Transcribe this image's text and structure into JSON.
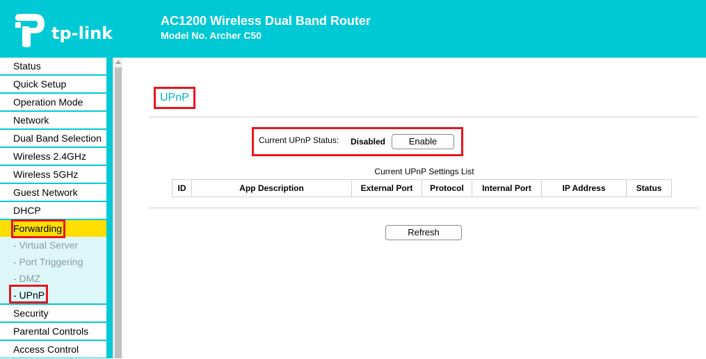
{
  "header": {
    "logo_text": "tp-link",
    "title": "AC1200 Wireless Dual Band Router",
    "model": "Model No. Archer C50"
  },
  "sidebar": {
    "items": [
      {
        "label": "Status"
      },
      {
        "label": "Quick Setup"
      },
      {
        "label": "Operation Mode"
      },
      {
        "label": "Network"
      },
      {
        "label": "Dual Band Selection"
      },
      {
        "label": "Wireless 2.4GHz"
      },
      {
        "label": "Wireless 5GHz"
      },
      {
        "label": "Guest Network"
      },
      {
        "label": "DHCP"
      },
      {
        "label": "Forwarding",
        "active": true
      },
      {
        "label": "Security"
      },
      {
        "label": "Parental Controls"
      },
      {
        "label": "Access Control"
      }
    ],
    "forwarding_sub": [
      {
        "label": "- Virtual Server"
      },
      {
        "label": "- Port Triggering"
      },
      {
        "label": "- DMZ"
      },
      {
        "label": "- UPnP",
        "active": true
      }
    ]
  },
  "main": {
    "page_title": "UPnP",
    "status_label": "Current UPnP Status:",
    "status_value": "Disabled",
    "enable_label": "Enable",
    "list_title": "Current UPnP Settings List",
    "columns": [
      "ID",
      "App Description",
      "External Port",
      "Protocol",
      "Internal Port",
      "IP Address",
      "Status"
    ],
    "refresh_label": "Refresh"
  },
  "colors": {
    "brand": "#00c9d6",
    "active_menu": "#ffde00",
    "highlight": "#e8141e",
    "submenu_bg": "#ddf7f9"
  }
}
